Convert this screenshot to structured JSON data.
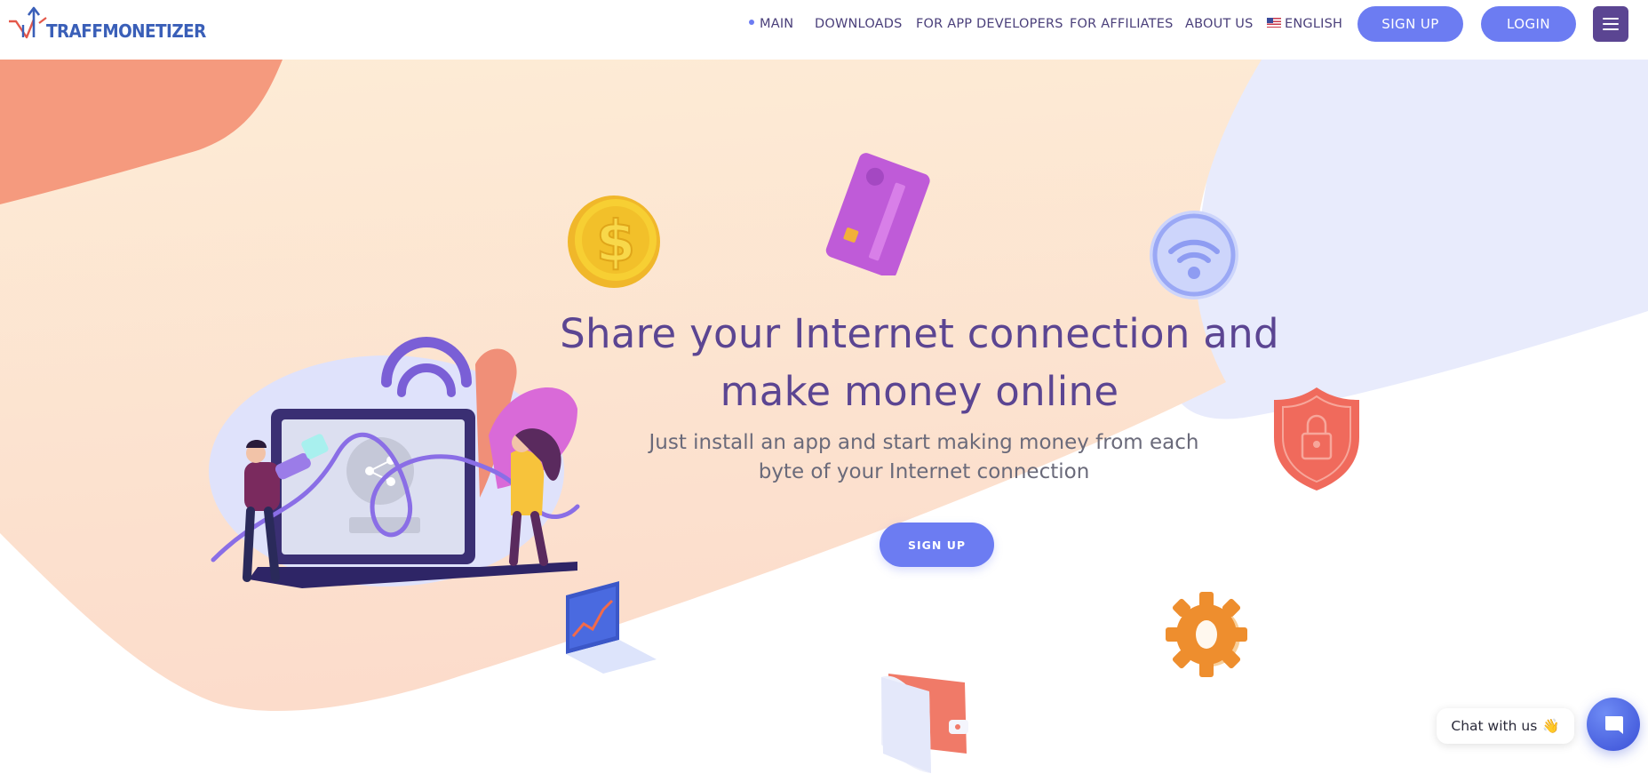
{
  "brand": {
    "name": "TRAFFMONETIZER",
    "color": "#3a5fb8",
    "accent": "#e4584a"
  },
  "nav": {
    "items": [
      {
        "label": "MAIN",
        "active": true
      },
      {
        "label": "DOWNLOADS"
      },
      {
        "label": "FOR APP DEVELOPERS"
      },
      {
        "label": "FOR AFFILIATES"
      },
      {
        "label": "ABOUT US"
      },
      {
        "label": "ENGLISH",
        "icon": "us-flag-icon"
      }
    ],
    "signup_label": "SIGN UP",
    "login_label": "LOGIN",
    "menu_icon": "hamburger-icon"
  },
  "hero": {
    "title_line1": "Share your Internet connection and",
    "title_line2": "make money online",
    "subtitle_line1": "Just install an app and start making money from each",
    "subtitle_line2": "byte of your Internet connection",
    "cta_label": "SIGN UP"
  },
  "floating_icons": [
    "dollar-coin-icon",
    "credit-card-icon",
    "wifi-circle-icon",
    "shield-lock-icon",
    "chart-laptop-icon",
    "gear-icon",
    "wallet-icon"
  ],
  "chat": {
    "label": "Chat with us",
    "emoji": "👋",
    "button_icon": "chat-icon"
  },
  "colors": {
    "primary": "#6c7cf2",
    "headline": "#5b4592",
    "peach": "#fde6cf",
    "coral": "#f3957a",
    "lavender": "#e6e9fc"
  }
}
